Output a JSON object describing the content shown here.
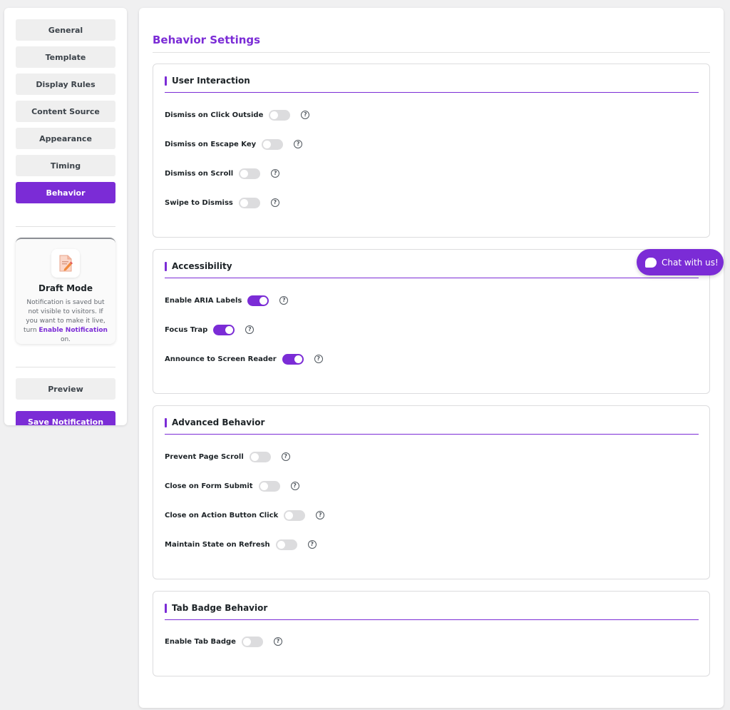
{
  "sidebar": {
    "nav": [
      {
        "label": "General",
        "active": false
      },
      {
        "label": "Template",
        "active": false
      },
      {
        "label": "Display Rules",
        "active": false
      },
      {
        "label": "Content Source",
        "active": false
      },
      {
        "label": "Appearance",
        "active": false
      },
      {
        "label": "Timing",
        "active": false
      },
      {
        "label": "Behavior",
        "active": true
      }
    ],
    "draft": {
      "title": "Draft Mode",
      "text_before": "Notification is saved but not visible to visitors. If you want to make it live, turn ",
      "link": "Enable Notification",
      "text_after": " on."
    },
    "preview_label": "Preview",
    "save_label": "Save Notification"
  },
  "main": {
    "title": "Behavior Settings",
    "sections": [
      {
        "title": "User Interaction",
        "rows": [
          {
            "label": "Dismiss on Click Outside",
            "on": false
          },
          {
            "label": "Dismiss on Escape Key",
            "on": false
          },
          {
            "label": "Dismiss on Scroll",
            "on": false
          },
          {
            "label": "Swipe to Dismiss",
            "on": false
          }
        ]
      },
      {
        "title": "Accessibility",
        "rows": [
          {
            "label": "Enable ARIA Labels",
            "on": true
          },
          {
            "label": "Focus Trap",
            "on": true
          },
          {
            "label": "Announce to Screen Reader",
            "on": true
          }
        ]
      },
      {
        "title": "Advanced Behavior",
        "rows": [
          {
            "label": "Prevent Page Scroll",
            "on": false
          },
          {
            "label": "Close on Form Submit",
            "on": false
          },
          {
            "label": "Close on Action Button Click",
            "on": false
          },
          {
            "label": "Maintain State on Refresh",
            "on": false
          }
        ]
      },
      {
        "title": "Tab Badge Behavior",
        "rows": [
          {
            "label": "Enable Tab Badge",
            "on": false
          }
        ]
      }
    ],
    "help_glyph": "?"
  },
  "chat": {
    "label": "Chat with us!"
  },
  "colors": {
    "accent": "#7b2cd6",
    "toggle_off": "#dcdcde"
  }
}
